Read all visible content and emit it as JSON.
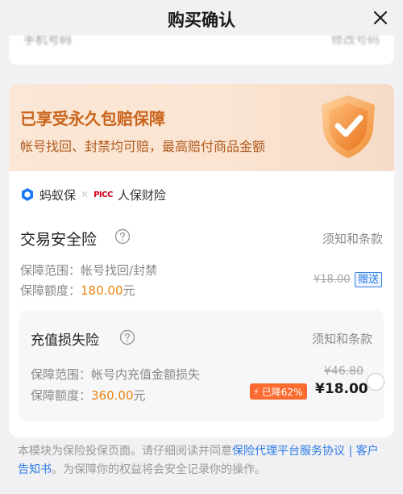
{
  "header": {
    "title": "购买确认"
  },
  "previous_card": {
    "left_text": "手机号码",
    "right_text": "修改号码"
  },
  "banner": {
    "title": "已享受永久包赔保障",
    "subtitle": "帐号找回、封禁均可赔，最高赔付商品金额"
  },
  "providers": {
    "ant": "蚂蚁保",
    "picc_mark": "PICC",
    "picc": "人保财险"
  },
  "insurance1": {
    "name": "交易安全险",
    "terms": "须知和条款",
    "scope_label": "保障范围：",
    "scope_value": "帐号找回/封禁",
    "amount_label": "保障额度：",
    "amount_value": "180.00",
    "amount_unit": "元",
    "original_price": "¥18.00",
    "gift_badge": "赠送"
  },
  "insurance2": {
    "name": "充值损失险",
    "terms": "须知和条款",
    "scope_label": "保障范围：",
    "scope_value": "帐号内充值金额损失",
    "amount_label": "保障额度：",
    "amount_value": "360.00",
    "amount_unit": "元",
    "original_price": "¥46.80",
    "discount": "已降62%",
    "price": "¥18.00",
    "selected": false
  },
  "footer": {
    "text_before": "本模块为保险投保页面。请仔细阅读并同意",
    "link1": "保险代理平台服务协议",
    "separator": " | ",
    "link2": "客户告知书",
    "text_after": "。为保障你的权益将会安全记录你的操作。"
  },
  "colors": {
    "accent_orange": "#e8840e",
    "banner_title": "#c9641b",
    "link_blue": "#2d7be5",
    "discount_bg": "#fb6a2e"
  }
}
